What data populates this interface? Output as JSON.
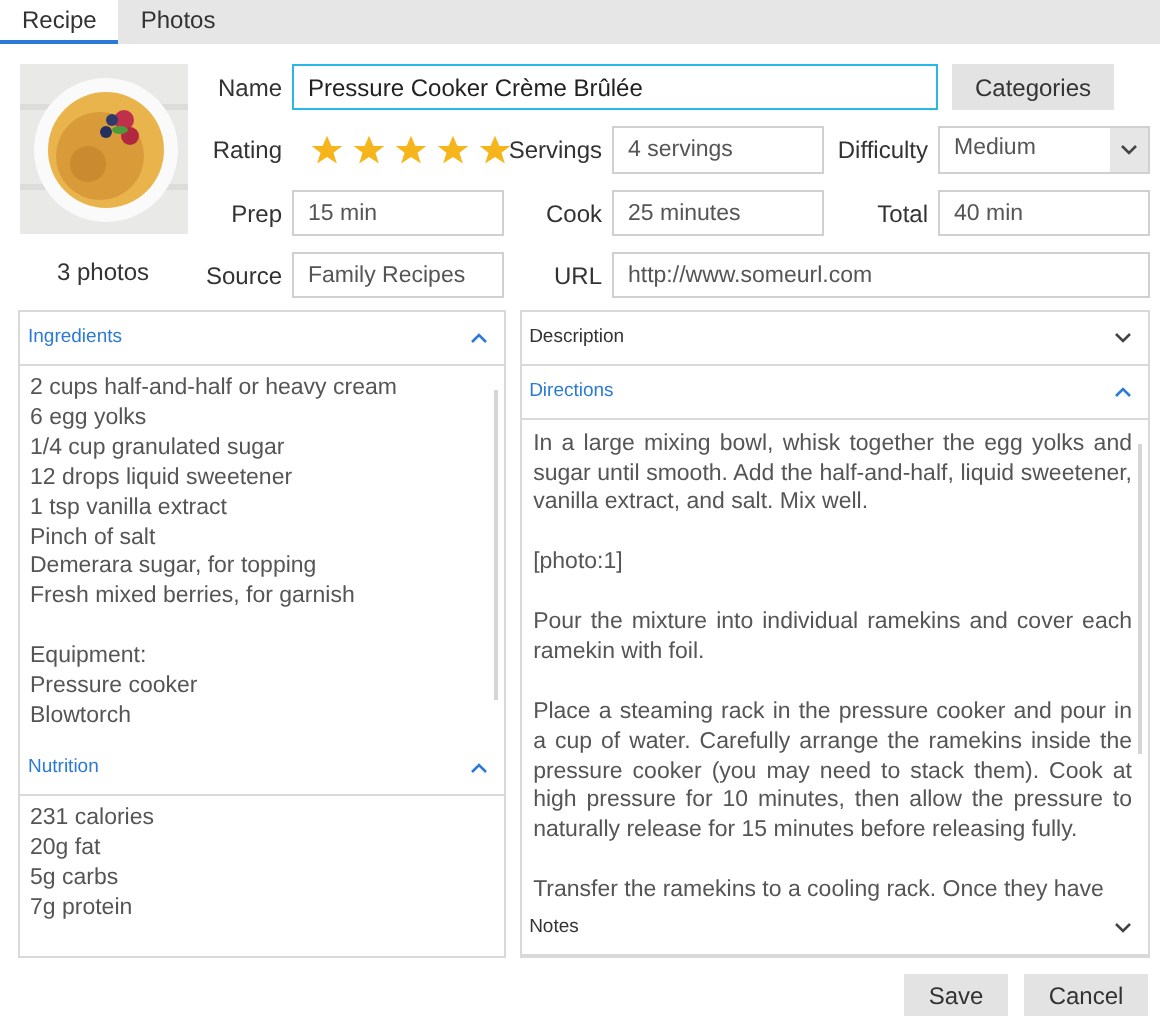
{
  "tabs": [
    {
      "label": "Recipe",
      "selected": true
    },
    {
      "label": "Photos",
      "selected": false
    }
  ],
  "photo": {
    "kind": "picture",
    "caption": "3 photos"
  },
  "form": {
    "name": {
      "label": "Name",
      "value": "Pressure Cooker Crème Brûlée",
      "focused": true
    },
    "categories_button": "Categories",
    "rating": {
      "label": "Rating",
      "stars": 5
    },
    "servings": {
      "label": "Servings",
      "value": "4 servings"
    },
    "difficulty": {
      "label": "Difficulty",
      "value": "Medium"
    },
    "prep": {
      "label": "Prep",
      "value": "15 min"
    },
    "cook": {
      "label": "Cook",
      "value": "25 minutes"
    },
    "total": {
      "label": "Total",
      "value": "40 min"
    },
    "source": {
      "label": "Source",
      "value": "Family Recipes"
    },
    "url": {
      "label": "URL",
      "value": "http://www.someurl.com"
    }
  },
  "left_panels": [
    {
      "title": "Ingredients",
      "expanded": true,
      "scrollbar": true,
      "groups": [
        [
          "2 cups half-and-half or heavy cream",
          "6 egg yolks",
          "1/4 cup granulated sugar",
          "12 drops liquid sweetener",
          "1 tsp vanilla extract",
          "Pinch of salt",
          "Demerara sugar, for topping",
          "Fresh mixed berries, for garnish"
        ],
        [
          "Equipment:",
          "Pressure cooker",
          "Blowtorch"
        ]
      ]
    },
    {
      "title": "Nutrition",
      "expanded": true,
      "groups": [
        [
          "231 calories",
          "20g fat",
          "5g carbs",
          "7g protein"
        ]
      ]
    }
  ],
  "right_panels": [
    {
      "title": "Description",
      "expanded": false
    },
    {
      "title": "Directions",
      "expanded": true,
      "scrollbar": true,
      "paragraphs": [
        "In a large mixing bowl, whisk together the egg yolks and sugar until smooth. Add the half-and-half, liquid sweetener, vanilla extract, and salt. Mix well.",
        "[photo:1]",
        "Pour the mixture into individual ramekins and cover each ramekin with foil.",
        "Place a steaming rack in the pressure cooker and pour in a cup of water. Carefully arrange the ramekins inside the pressure cooker (you may need to stack them). Cook at high pressure for 10 minutes, then allow the pressure to naturally release for 15 minutes before releasing fully.",
        "Transfer the ramekins to a cooling rack. Once they have"
      ]
    },
    {
      "title": "Notes",
      "expanded": false
    }
  ],
  "buttons": [
    "Save",
    "Cancel"
  ]
}
